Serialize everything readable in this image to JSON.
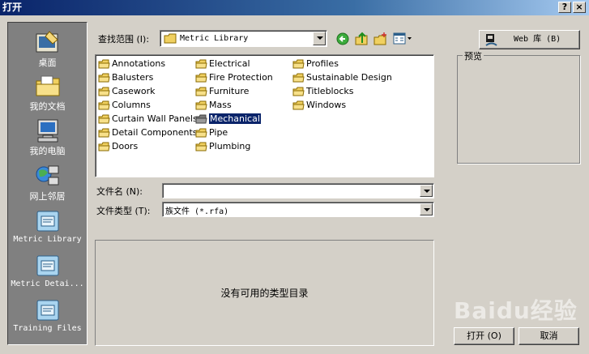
{
  "window": {
    "title": "打开",
    "help_glyph": "?",
    "close_glyph": "×"
  },
  "places": [
    {
      "label": "桌面",
      "icon": "desktop-icon"
    },
    {
      "label": "我的文档",
      "icon": "my-documents-icon"
    },
    {
      "label": "我的电脑",
      "icon": "my-computer-icon"
    },
    {
      "label": "网上邻居",
      "icon": "network-places-icon"
    },
    {
      "label": "Metric Library",
      "icon": "library-folder-icon"
    },
    {
      "label": "Metric Detai...",
      "icon": "library-folder-icon"
    },
    {
      "label": "Training Files",
      "icon": "library-folder-icon"
    }
  ],
  "lookin": {
    "label": "查找范围 (I):",
    "value": "Metric Library"
  },
  "toolbar_icons": [
    "back-icon",
    "up-folder-icon",
    "new-folder-icon",
    "view-menu-icon"
  ],
  "files": {
    "col1": [
      "Annotations",
      "Balusters",
      "Casework",
      "Columns",
      "Curtain Wall Panels",
      "Detail Components",
      "Doors"
    ],
    "col2": [
      "Electrical",
      "Fire Protection",
      "Furniture",
      "Mass",
      "Mechanical",
      "Pipe",
      "Plumbing"
    ],
    "col3": [
      "Profiles",
      "Sustainable Design",
      "Titleblocks",
      "Windows"
    ],
    "selected": "Mechanical"
  },
  "filename": {
    "label": "文件名 (N):",
    "value": ""
  },
  "filetype": {
    "label": "文件类型 (T):",
    "value": "族文件 (*.rfa)"
  },
  "type_catalog": {
    "message": "没有可用的类型目录"
  },
  "web_button": {
    "label": "Web 库 (B)"
  },
  "preview": {
    "label": "预览"
  },
  "open_button": {
    "label": "打开 (O)"
  },
  "cancel_button": {
    "label": "取消"
  },
  "watermark": {
    "text": "Baidu经验"
  }
}
